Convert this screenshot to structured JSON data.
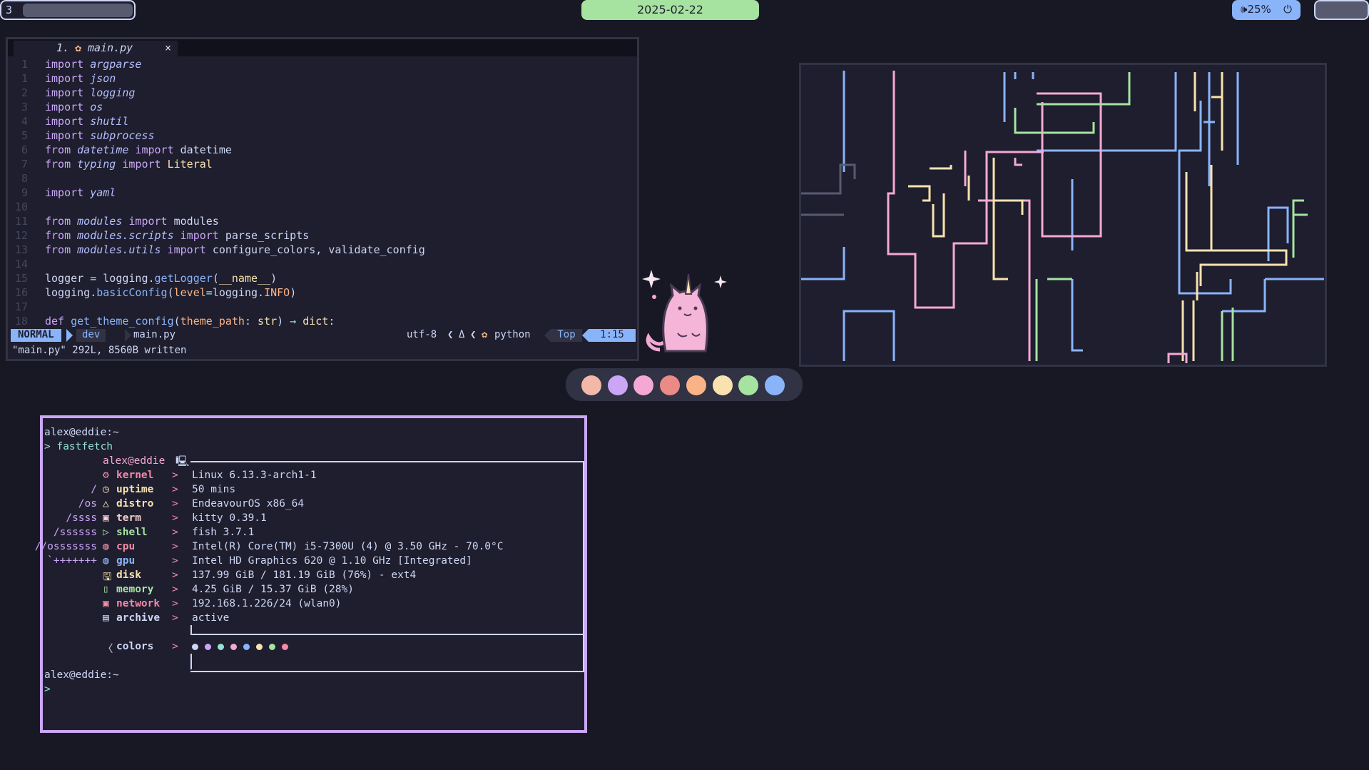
{
  "topbar": {
    "workspace": "3",
    "date": "2025-02-22",
    "volume": "🕪25%",
    "power_icon": "⏻"
  },
  "editor": {
    "tab_label": "1.",
    "tab_file": "main.py",
    "tab_close": "×",
    "lines": [
      {
        "n": "1",
        "html": "<span class='kw'>import</span> <span class='mod'>argparse</span>"
      },
      {
        "n": "1",
        "html": "<span class='kw'>import</span> <span class='mod'>json</span>"
      },
      {
        "n": "2",
        "html": "<span class='kw'>import</span> <span class='mod'>logging</span>"
      },
      {
        "n": "3",
        "html": "<span class='kw'>import</span> <span class='mod'>os</span>"
      },
      {
        "n": "4",
        "html": "<span class='kw'>import</span> <span class='mod'>shutil</span>"
      },
      {
        "n": "5",
        "html": "<span class='kw'>import</span> <span class='mod'>subprocess</span>"
      },
      {
        "n": "6",
        "html": "<span class='kw'>from</span> <span class='mod'>datetime</span> <span class='kw'>import</span> <span class='id'>datetime</span>"
      },
      {
        "n": "7",
        "html": "<span class='kw'>from</span> <span class='mod'>typing</span> <span class='kw'>import</span> <span class='ty'>Literal</span>"
      },
      {
        "n": "8",
        "html": ""
      },
      {
        "n": "9",
        "html": "<span class='kw'>import</span> <span class='mod'>yaml</span>"
      },
      {
        "n": "10",
        "html": ""
      },
      {
        "n": "11",
        "html": "<span class='kw'>from</span> <span class='mod'>modules</span> <span class='kw'>import</span> <span class='id'>modules</span>"
      },
      {
        "n": "12",
        "html": "<span class='kw'>from</span> <span class='mod'>modules.scripts</span> <span class='kw'>import</span> <span class='id'>parse_scripts</span>"
      },
      {
        "n": "13",
        "html": "<span class='kw'>from</span> <span class='mod'>modules.utils</span> <span class='kw'>import</span> <span class='id'>configure_colors, validate_config</span>"
      },
      {
        "n": "14",
        "html": ""
      },
      {
        "n": "15",
        "html": "<span class='id'>logger</span> <span class='op'>=</span> <span class='id'>logging.</span><span class='fn'>getLogger</span><span class='id'>(</span><span class='str'>__name__</span><span class='id'>)</span>"
      },
      {
        "n": "16",
        "html": "<span class='id'>logging.</span><span class='fn'>basicConfig</span><span class='id'>(</span><span class='at'>level</span><span class='op'>=</span><span class='id'>logging.</span><span class='at'>INFO</span><span class='id'>)</span>"
      },
      {
        "n": "17",
        "html": ""
      },
      {
        "n": "18",
        "html": "<span class='kw'>def</span> <span class='fn'>get_theme_config</span><span class='id'>(</span><span class='at'>theme_path</span><span class='id'>: </span><span class='ty'>str</span><span class='id'>) </span><span class='op'>→</span> <span class='ty'>dict</span><span class='id'>:</span>"
      }
    ],
    "status": {
      "mode": "NORMAL",
      "branch": " dev",
      "file": "main.py",
      "encoding": "utf-8",
      "delta": "Δ",
      "filetype": "python",
      "position": "Top",
      "cursor": "1:15"
    },
    "cmdline": "\"main.py\" 292L, 8560B written"
  },
  "dock_colors": [
    "#f2b8a8",
    "#cba6f7",
    "#f5a8d4",
    "#eb8a86",
    "#fab387",
    "#f9e2af",
    "#a6e3a1",
    "#89b4fa"
  ],
  "terminal": {
    "prompt1": "alex@eddie:~",
    "command": "> fastfetch",
    "header": "alex@eddie",
    "rows": [
      {
        "art": "",
        "icon": "⚙",
        "label": "kernel",
        "value": "Linux 6.13.3-arch1-1",
        "color": "#f38ba8"
      },
      {
        "art": "/",
        "icon": "◷",
        "label": "uptime",
        "value": "50 mins",
        "color": "#f9e2af"
      },
      {
        "art": "/os",
        "icon": "△",
        "label": "distro",
        "value": "EndeavourOS x86_64",
        "color": "#f9e2af"
      },
      {
        "art": "/ssss",
        "icon": "▣",
        "label": "term",
        "value": "kitty 0.39.1",
        "color": "#f2cdcd"
      },
      {
        "art": "/ssssss",
        "icon": "▷",
        "label": "shell",
        "value": "fish 3.7.1",
        "color": "#a6e3a1"
      },
      {
        "art": "//osssssss",
        "icon": "◍",
        "label": "cpu",
        "value": "Intel(R) Core(TM) i5-7300U (4) @ 3.50 GHz - 70.0°C",
        "color": "#f38ba8"
      },
      {
        "art": "`+++++++",
        "icon": "◍",
        "label": "gpu",
        "value": "Intel HD Graphics 620 @ 1.10 GHz [Integrated]",
        "color": "#89b4fa"
      },
      {
        "art": "",
        "icon": "🖫",
        "label": "disk",
        "value": "137.99 GiB / 181.19 GiB (76%) - ext4",
        "color": "#f9e2af"
      },
      {
        "art": "",
        "icon": "▯",
        "label": "memory",
        "value": "4.25 GiB / 15.37 GiB (28%)",
        "color": "#a6e3a1"
      },
      {
        "art": "",
        "icon": "▣",
        "label": "network",
        "value": "192.168.1.226/24 (wlan0)",
        "color": "#f38ba8"
      },
      {
        "art": "",
        "icon": "▤",
        "label": "archive",
        "value": "active",
        "color": "#cdd6f4"
      }
    ],
    "colors_label": "colors",
    "separator": ">",
    "prompt2": "alex@eddie:~",
    "prompt2_cursor": ">"
  }
}
